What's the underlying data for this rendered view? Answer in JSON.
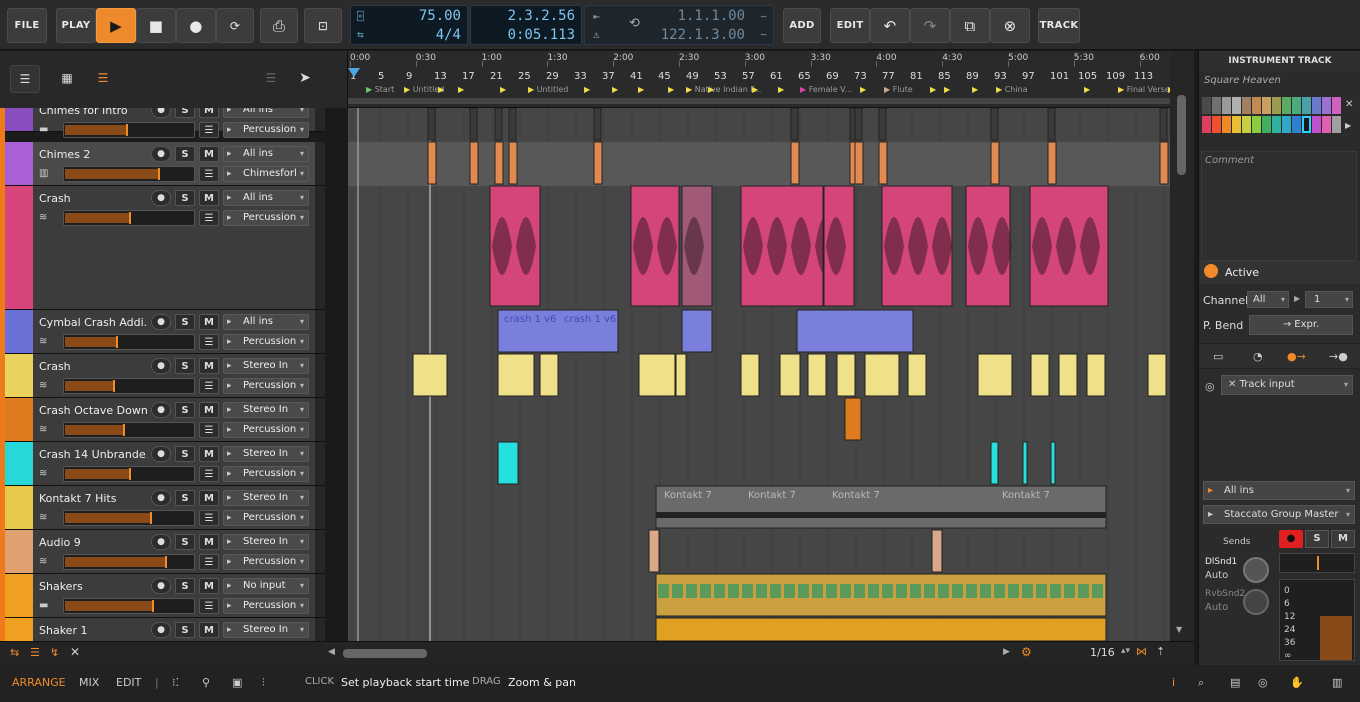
{
  "toolbar": {
    "file": "FILE",
    "play": "PLAY",
    "add": "ADD",
    "edit": "EDIT",
    "track": "TRACK"
  },
  "transport": {
    "tempo": "75.00",
    "meter": "4/4",
    "position": "2.3.2.56",
    "time": "0:05.113",
    "loop_start": "1.1.1.00",
    "loop_end": "122.1.3.00"
  },
  "ruler": {
    "times": [
      "0:00",
      "0:30",
      "1:00",
      "1:30",
      "2:00",
      "2:30",
      "3:00",
      "3:30",
      "4:00",
      "4:30",
      "5:00",
      "5:30",
      "6:00"
    ],
    "bars": [
      "1",
      "5",
      "9",
      "13",
      "17",
      "21",
      "25",
      "29",
      "33",
      "37",
      "41",
      "45",
      "49",
      "53",
      "57",
      "61",
      "65",
      "69",
      "73",
      "77",
      "81",
      "85",
      "89",
      "93",
      "97",
      "101",
      "105",
      "109",
      "113"
    ],
    "markers": [
      "Start",
      "Untitled",
      "Untitled",
      "Native Indian F...",
      "Female V...",
      "Flute",
      "China",
      "Final Verse"
    ]
  },
  "tracks": [
    {
      "name": "Chimes for Intro",
      "input": "All ins",
      "output": "Percussion",
      "color": "#8a4dc0",
      "fill": 0.48,
      "icon": "folder"
    },
    {
      "name": "Chimes 2",
      "input": "All ins",
      "output": "Chimesforl",
      "color": "#a95fd5",
      "fill": 0.72,
      "icon": "piano"
    },
    {
      "name": "Crash",
      "input": "All ins",
      "output": "Percussion",
      "color": "#d8457a",
      "fill": 0.5,
      "icon": "wave"
    },
    {
      "name": "Cymbal Crash Addi...",
      "input": "All ins",
      "output": "Percussion",
      "color": "#6b6fd6",
      "fill": 0.4,
      "icon": "wave"
    },
    {
      "name": "Crash",
      "input": "Stereo In",
      "output": "Percussion",
      "color": "#e9d35e",
      "fill": 0.38,
      "icon": "wave"
    },
    {
      "name": "Crash Octave Down",
      "input": "Stereo In",
      "output": "Percussion",
      "color": "#e07a1e",
      "fill": 0.45,
      "icon": "wave"
    },
    {
      "name": "Crash 14 Unbrande...",
      "input": "Stereo In",
      "output": "Percussion",
      "color": "#26d8d8",
      "fill": 0.5,
      "icon": "wave"
    },
    {
      "name": "Kontakt 7 Hits",
      "input": "Stereo In",
      "output": "Percussion",
      "color": "#e8c848",
      "fill": 0.66,
      "icon": "wave"
    },
    {
      "name": "Audio 9",
      "input": "Stereo In",
      "output": "Percussion",
      "color": "#e0a070",
      "fill": 0.78,
      "icon": "wave"
    },
    {
      "name": "Shakers",
      "input": "No input",
      "output": "Percussion",
      "color": "#f0a020",
      "fill": 0.68,
      "icon": "folder"
    },
    {
      "name": "Shaker 1",
      "input": "Stereo In",
      "output": "Percussion",
      "color": "#f0a020",
      "fill": 0.5,
      "icon": "wave"
    }
  ],
  "clips": {
    "cymbal_1": "crash 1 v6",
    "cymbal_2": "crash 1 v6",
    "kontakt": "Kontakt 7"
  },
  "inspector": {
    "title": "INSTRUMENT TRACK",
    "name": "Square Heaven",
    "comment": "Comment",
    "active": "Active",
    "channel_label": "Channel",
    "channel": "All",
    "channel_num": "1",
    "pbend_label": "P. Bend",
    "pbend": "→ Expr.",
    "track_input": "Track input",
    "input": "All ins",
    "output": "Staccato Group Master",
    "sends": "Sends",
    "send1": "DlSnd1",
    "send1_mode": "Auto",
    "send2": "RvbSnd2",
    "send2_mode": "Auto",
    "db": [
      "0",
      "6",
      "12",
      "24",
      "36",
      "∞"
    ],
    "s": "S",
    "m": "M"
  },
  "bottombar": {
    "arrange": "ARRANGE",
    "mix": "MIX",
    "edit": "EDIT",
    "click": "CLICK",
    "click_hint": "Set playback start time",
    "drag": "DRAG",
    "drag_hint": "Zoom & pan",
    "grid": "1/16"
  },
  "colors": {
    "accent": "#f08a2a",
    "lcd": "#7ec6ee"
  }
}
